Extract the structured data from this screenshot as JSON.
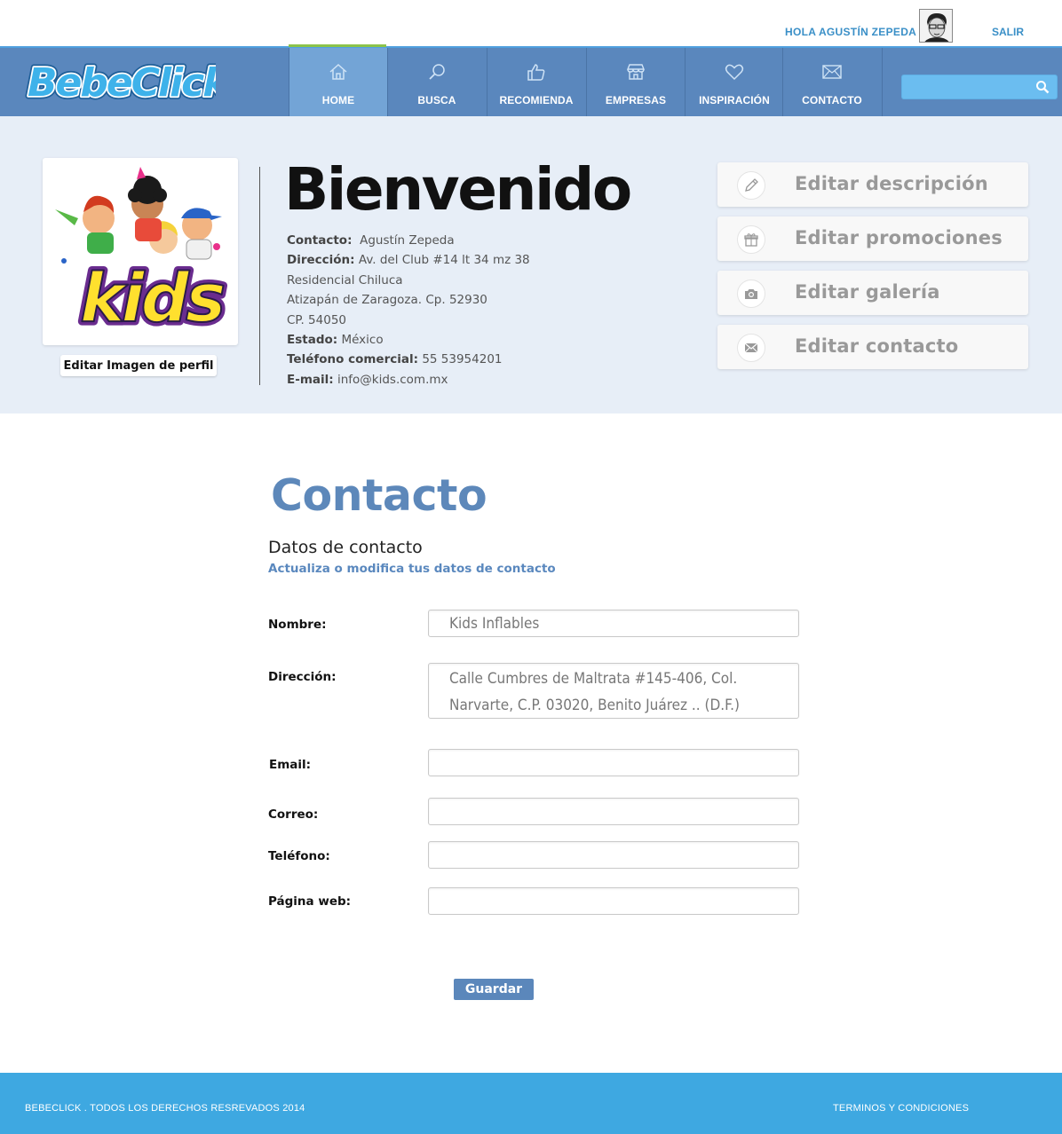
{
  "header": {
    "greeting": "HOLA AGUSTÍN ZEPEDA",
    "logout_label": "SALIR"
  },
  "brand": {
    "name": "BebeClick",
    "accent": "#5a87bd",
    "footer_color": "#3ea8e1"
  },
  "nav": {
    "items": [
      {
        "label": "HOME",
        "icon": "home-icon",
        "active": true
      },
      {
        "label": "BUSCA",
        "icon": "magnifier-icon"
      },
      {
        "label": "RECOMIENDA",
        "icon": "thumbs-up-icon"
      },
      {
        "label": "EMPRESAS",
        "icon": "store-icon"
      },
      {
        "label": "INSPIRACIÓN",
        "icon": "heart-icon"
      },
      {
        "label": "CONTACTO",
        "icon": "envelope-icon"
      }
    ],
    "search_placeholder": ""
  },
  "profile": {
    "edit_image_label": "Editar Imagen de perfil",
    "welcome": "Bienvenido",
    "contact_label": "Contacto:",
    "contact_value": "Agustín Zepeda",
    "address_label": "Dirección:",
    "address_line1": "Av. del Club #14 lt 34 mz 38",
    "address_line2": "Residencial Chiluca",
    "address_line3": "Atizapán de Zaragoza. Cp. 52930",
    "address_line4": "CP. 54050",
    "state_label": "Estado:",
    "state_value": "México",
    "phone_label": "Teléfono comercial:",
    "phone_value": "55 53954201",
    "email_label": "E-mail:",
    "email_value": "info@kids.com.mx",
    "logo_text": "Kids"
  },
  "actions": [
    {
      "label": "Editar descripción",
      "icon": "pencil-icon"
    },
    {
      "label": "Editar promociones",
      "icon": "gift-icon"
    },
    {
      "label": "Editar  galería",
      "icon": "camera-icon"
    },
    {
      "label": "Editar contacto",
      "icon": "envelope-icon"
    }
  ],
  "contact_form": {
    "title": "Contacto",
    "subtitle": "Datos de contacto",
    "description": "Actualiza o modifica tus datos de contacto",
    "fields": {
      "name_label": "Nombre:",
      "name_value": "Kids Inflables",
      "address_label": "Dirección:",
      "address_value": "Calle Cumbres de Maltrata #145-406, Col. Narvarte, C.P. 03020, Benito Juárez .. (D.F.)",
      "email_label": "Email:",
      "email_value": "",
      "mail_label": "Correo:",
      "mail_value": "",
      "phone_label": "Teléfono:",
      "phone_value": "",
      "web_label": "Página web:",
      "web_value": ""
    },
    "save_label": "Guardar"
  },
  "footer": {
    "copyright": "BEBECLICK . TODOS LOS DERECHOS RESREVADOS 2014",
    "terms": "TERMINOS Y CONDICIONES"
  }
}
